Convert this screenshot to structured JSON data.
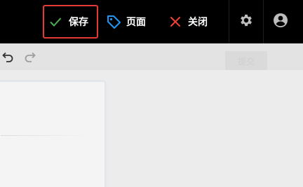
{
  "topbar": {
    "save_label": "保存",
    "page_label": "页面",
    "close_label": "关闭"
  },
  "icons": {
    "save": "check-icon",
    "page": "tag-icon",
    "close": "close-icon",
    "settings": "gear-icon",
    "account": "user-icon",
    "undo": "undo-icon",
    "redo": "redo-icon"
  },
  "colors": {
    "save_check": "#4caf50",
    "page_tag": "#2196f3",
    "close_x": "#f44336",
    "save_highlight": "#e53935"
  },
  "toolbar": {
    "action_label": "提交"
  }
}
